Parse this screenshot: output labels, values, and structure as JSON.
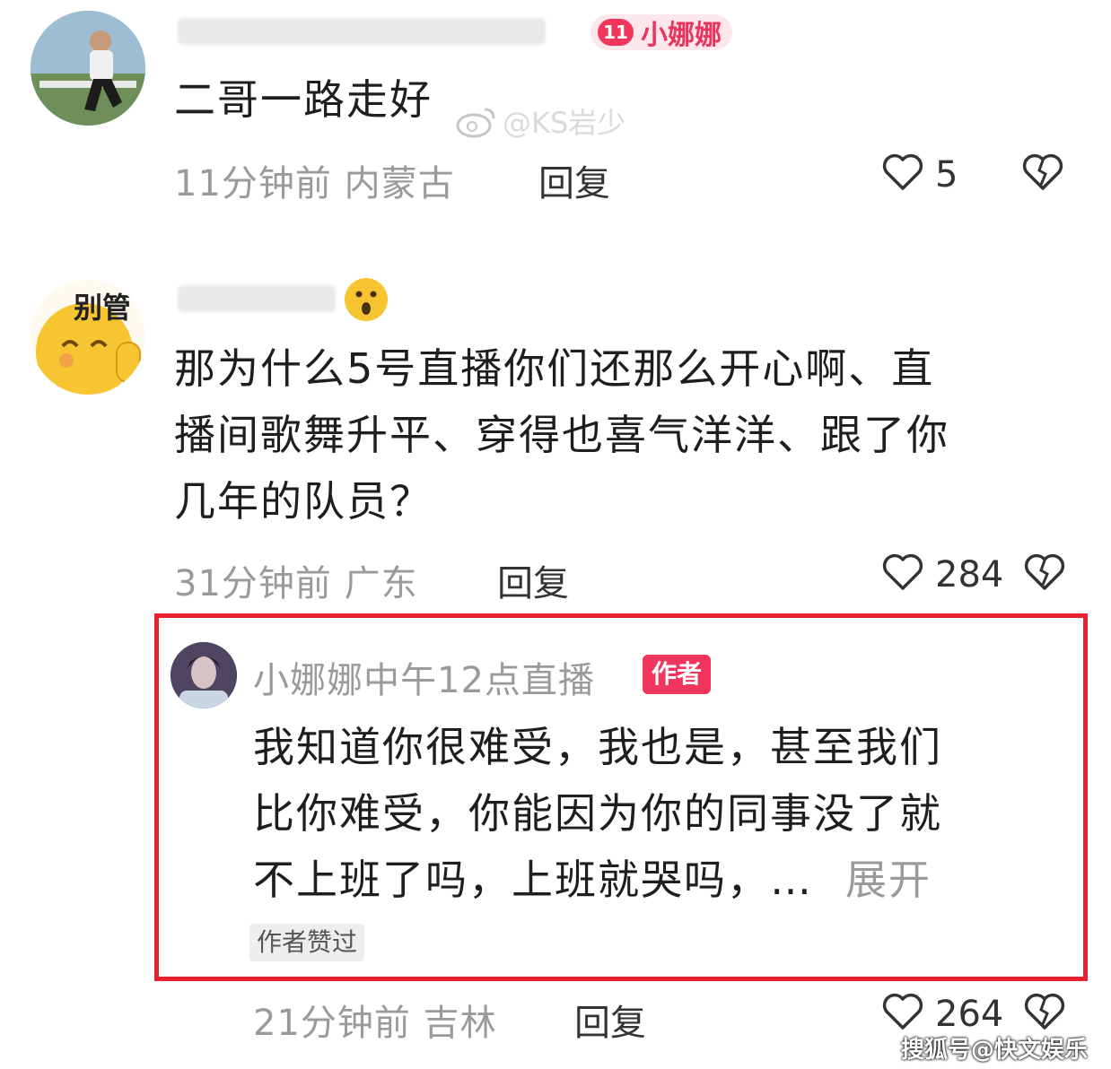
{
  "comments": [
    {
      "tag_level": "11",
      "tag_name": "小娜娜",
      "text": "二哥一路走好",
      "time_location": "11分钟前 内蒙古",
      "reply_label": "回复",
      "likes": "5"
    },
    {
      "avatar_text": "别管",
      "text_lines": [
        "那为什么5号直播你们还那么开心啊、直",
        "播间歌舞升平、穿得也喜气洋洋、跟了你",
        "几年的队员？"
      ],
      "time_location": "31分钟前 广东",
      "reply_label": "回复",
      "likes": "284",
      "reply": {
        "author": "小娜娜中午12点直播",
        "author_badge": "作者",
        "text_lines": [
          "我知道你很难受，我也是，甚至我们",
          "比你难受，你能因为你的同事没了就",
          "不上班了吗，上班就哭吗，…"
        ],
        "expand_label": "展开",
        "liked_tag": "作者赞过",
        "time_location": "21分钟前 吉林",
        "reply_label": "回复",
        "likes": "264"
      }
    }
  ],
  "watermarks": {
    "weibo": "@KS岩少",
    "sohu": "搜狐号@快文娱乐"
  },
  "colors": {
    "highlight_border": "#e8212f",
    "author_badge": "#f2355c"
  }
}
